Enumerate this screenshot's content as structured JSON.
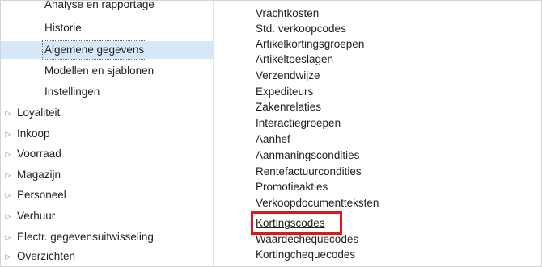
{
  "navigation": {
    "sub_items": [
      {
        "label": "Analyse en rapportage"
      },
      {
        "label": "Historie"
      },
      {
        "label": "Algemene gegevens"
      },
      {
        "label": "Modellen en sjablonen"
      },
      {
        "label": "Instellingen"
      }
    ],
    "top_items": [
      {
        "label": "Loyaliteit"
      },
      {
        "label": "Inkoop"
      },
      {
        "label": "Voorraad"
      },
      {
        "label": "Magazijn"
      },
      {
        "label": "Personeel"
      },
      {
        "label": "Verhuur"
      },
      {
        "label": "Electr. gegevensuitwisseling"
      },
      {
        "label": "Overzichten"
      }
    ],
    "expand_glyph": "▷",
    "selected_item": "Algemene gegevens"
  },
  "links": [
    {
      "label": "Vrachtkosten"
    },
    {
      "label": "Std. verkoopcodes"
    },
    {
      "label": "Artikelkortingsgroepen"
    },
    {
      "label": "Artikeltoeslagen"
    },
    {
      "label": "Verzendwijze"
    },
    {
      "label": "Expediteurs"
    },
    {
      "label": "Zakenrelaties"
    },
    {
      "label": "Interactiegroepen"
    },
    {
      "label": "Aanhef"
    },
    {
      "label": "Aanmaningscondities"
    },
    {
      "label": "Rentefactuurcondities"
    },
    {
      "label": "Promotieakties"
    },
    {
      "label": "Verkoopdocumentteksten"
    },
    {
      "label": "Kortingscodes"
    },
    {
      "label": "Waardechequecodes"
    },
    {
      "label": "Kortingchequecodes"
    }
  ],
  "colors": {
    "selection_background": "#d6e8f7",
    "highlight_border": "#e0141b"
  }
}
